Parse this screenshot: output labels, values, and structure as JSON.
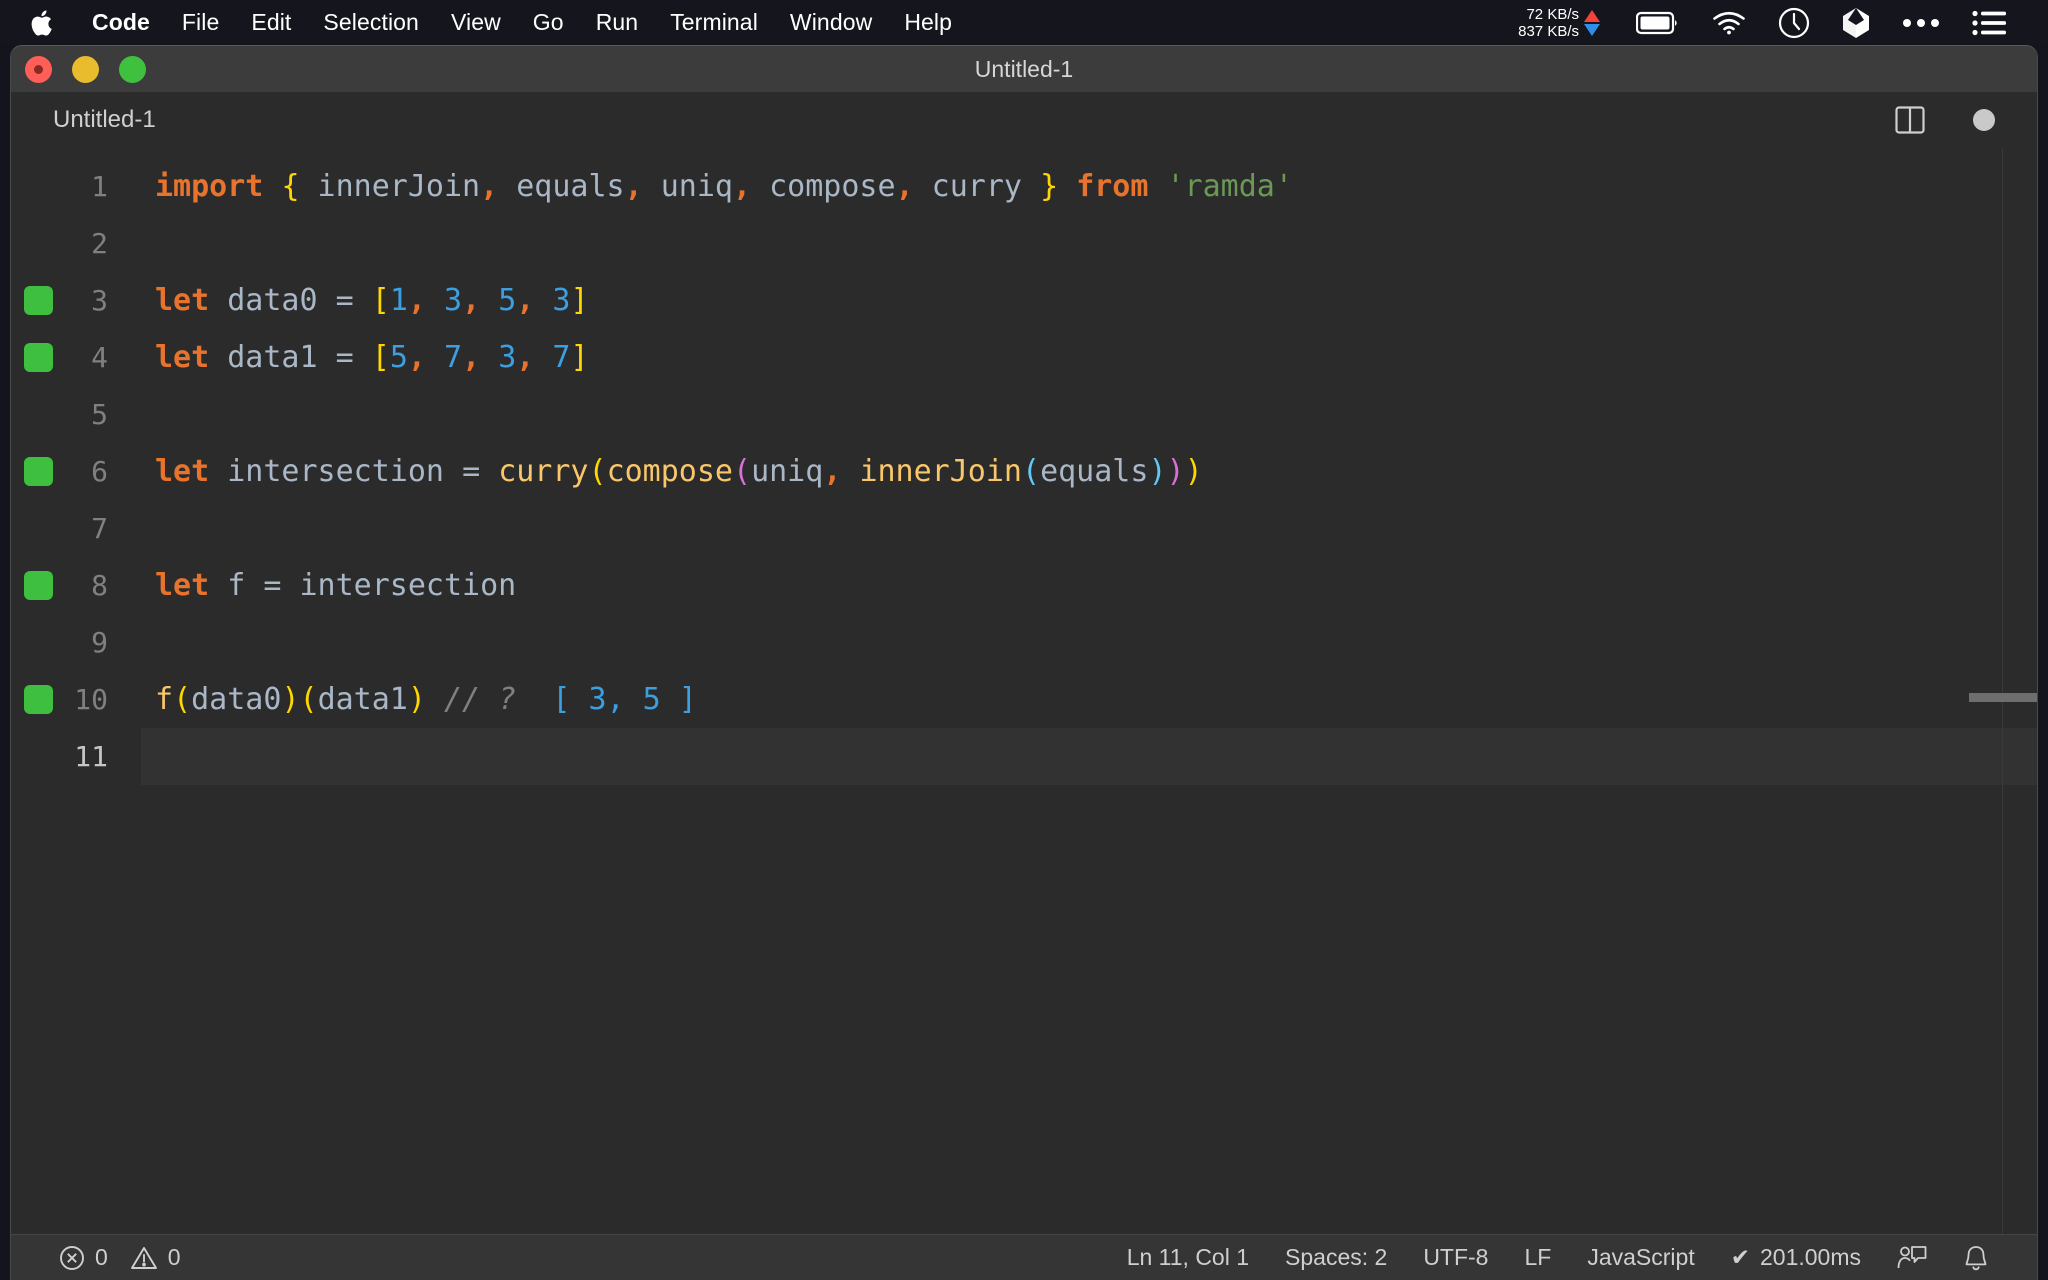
{
  "menubar": {
    "apple_icon": "apple-logo-icon",
    "items": [
      {
        "label": "Code",
        "bold": true
      },
      {
        "label": "File",
        "bold": false
      },
      {
        "label": "Edit",
        "bold": false
      },
      {
        "label": "Selection",
        "bold": false
      },
      {
        "label": "View",
        "bold": false
      },
      {
        "label": "Go",
        "bold": false
      },
      {
        "label": "Run",
        "bold": false
      },
      {
        "label": "Terminal",
        "bold": false
      },
      {
        "label": "Window",
        "bold": false
      },
      {
        "label": "Help",
        "bold": false
      }
    ],
    "network": {
      "upload": "72 KB/s",
      "download": "837 KB/s",
      "upload_color": "#f2433b",
      "download_color": "#2f8fe8"
    },
    "tray_icons": [
      "battery-icon",
      "wifi-icon",
      "clock-icon",
      "dropbox-icon",
      "ellipsis-icon",
      "control-center-list-icon"
    ]
  },
  "window": {
    "title": "Untitled-1",
    "traffic_lights": [
      "close-button",
      "minimize-button",
      "maximize-button"
    ]
  },
  "tabbar": {
    "tab_label": "Untitled-1",
    "split_editor_icon": "split-editor-icon",
    "dirty_indicator": "unsaved-changes-dot"
  },
  "editor": {
    "lines": [
      {
        "no": "1",
        "breakpoint": false,
        "active": false,
        "tokens": [
          {
            "t": "import",
            "c": "kw"
          },
          {
            "t": " ",
            "c": "punct"
          },
          {
            "t": "{",
            "c": "b1"
          },
          {
            "t": " innerJoin",
            "c": "ident"
          },
          {
            "t": ",",
            "c": "kw"
          },
          {
            "t": " equals",
            "c": "ident"
          },
          {
            "t": ",",
            "c": "kw"
          },
          {
            "t": " uniq",
            "c": "ident"
          },
          {
            "t": ",",
            "c": "kw"
          },
          {
            "t": " compose",
            "c": "ident"
          },
          {
            "t": ",",
            "c": "kw"
          },
          {
            "t": " curry ",
            "c": "ident"
          },
          {
            "t": "}",
            "c": "b1"
          },
          {
            "t": " ",
            "c": "punct"
          },
          {
            "t": "from",
            "c": "kw"
          },
          {
            "t": " ",
            "c": "punct"
          },
          {
            "t": "'ramda'",
            "c": "str"
          }
        ]
      },
      {
        "no": "2",
        "breakpoint": false,
        "active": false,
        "tokens": []
      },
      {
        "no": "3",
        "breakpoint": true,
        "active": false,
        "tokens": [
          {
            "t": "let",
            "c": "kw"
          },
          {
            "t": " data0 ",
            "c": "ident"
          },
          {
            "t": "=",
            "c": "op"
          },
          {
            "t": " ",
            "c": "punct"
          },
          {
            "t": "[",
            "c": "b1"
          },
          {
            "t": "1",
            "c": "num"
          },
          {
            "t": ",",
            "c": "kw"
          },
          {
            "t": " ",
            "c": "punct"
          },
          {
            "t": "3",
            "c": "num"
          },
          {
            "t": ",",
            "c": "kw"
          },
          {
            "t": " ",
            "c": "punct"
          },
          {
            "t": "5",
            "c": "num"
          },
          {
            "t": ",",
            "c": "kw"
          },
          {
            "t": " ",
            "c": "punct"
          },
          {
            "t": "3",
            "c": "num"
          },
          {
            "t": "]",
            "c": "b1"
          }
        ]
      },
      {
        "no": "4",
        "breakpoint": true,
        "active": false,
        "tokens": [
          {
            "t": "let",
            "c": "kw"
          },
          {
            "t": " data1 ",
            "c": "ident"
          },
          {
            "t": "=",
            "c": "op"
          },
          {
            "t": " ",
            "c": "punct"
          },
          {
            "t": "[",
            "c": "b1"
          },
          {
            "t": "5",
            "c": "num"
          },
          {
            "t": ",",
            "c": "kw"
          },
          {
            "t": " ",
            "c": "punct"
          },
          {
            "t": "7",
            "c": "num"
          },
          {
            "t": ",",
            "c": "kw"
          },
          {
            "t": " ",
            "c": "punct"
          },
          {
            "t": "3",
            "c": "num"
          },
          {
            "t": ",",
            "c": "kw"
          },
          {
            "t": " ",
            "c": "punct"
          },
          {
            "t": "7",
            "c": "num"
          },
          {
            "t": "]",
            "c": "b1"
          }
        ]
      },
      {
        "no": "5",
        "breakpoint": false,
        "active": false,
        "tokens": []
      },
      {
        "no": "6",
        "breakpoint": true,
        "active": false,
        "tokens": [
          {
            "t": "let",
            "c": "kw"
          },
          {
            "t": " intersection ",
            "c": "ident"
          },
          {
            "t": "=",
            "c": "op"
          },
          {
            "t": " ",
            "c": "punct"
          },
          {
            "t": "curry",
            "c": "fn"
          },
          {
            "t": "(",
            "c": "b1"
          },
          {
            "t": "compose",
            "c": "fn"
          },
          {
            "t": "(",
            "c": "b2"
          },
          {
            "t": "uniq",
            "c": "ident"
          },
          {
            "t": ",",
            "c": "kw"
          },
          {
            "t": " ",
            "c": "punct"
          },
          {
            "t": "innerJoin",
            "c": "fn"
          },
          {
            "t": "(",
            "c": "b3"
          },
          {
            "t": "equals",
            "c": "ident"
          },
          {
            "t": ")",
            "c": "b3"
          },
          {
            "t": ")",
            "c": "b2"
          },
          {
            "t": ")",
            "c": "b1"
          }
        ]
      },
      {
        "no": "7",
        "breakpoint": false,
        "active": false,
        "tokens": []
      },
      {
        "no": "8",
        "breakpoint": true,
        "active": false,
        "tokens": [
          {
            "t": "let",
            "c": "kw"
          },
          {
            "t": " f ",
            "c": "ident"
          },
          {
            "t": "=",
            "c": "op"
          },
          {
            "t": " intersection",
            "c": "ident"
          }
        ]
      },
      {
        "no": "9",
        "breakpoint": false,
        "active": false,
        "tokens": []
      },
      {
        "no": "10",
        "breakpoint": true,
        "active": false,
        "tokens": [
          {
            "t": "f",
            "c": "fn"
          },
          {
            "t": "(",
            "c": "b1"
          },
          {
            "t": "data0",
            "c": "ident"
          },
          {
            "t": ")",
            "c": "b1"
          },
          {
            "t": "(",
            "c": "b1"
          },
          {
            "t": "data1",
            "c": "ident"
          },
          {
            "t": ")",
            "c": "b1"
          },
          {
            "t": " ",
            "c": "punct"
          },
          {
            "t": "// ?",
            "c": "comment"
          },
          {
            "t": "  ",
            "c": "punct"
          },
          {
            "t": "[ 3, 5 ]",
            "c": "result"
          }
        ]
      },
      {
        "no": "11",
        "breakpoint": false,
        "active": true,
        "tokens": []
      }
    ]
  },
  "statusbar": {
    "errors_icon": "error-circle-icon",
    "errors_count": "0",
    "warnings_icon": "warning-triangle-icon",
    "warnings_count": "0",
    "cursor_position": "Ln 11, Col 1",
    "indentation": "Spaces: 2",
    "encoding": "UTF-8",
    "eol": "LF",
    "language": "JavaScript",
    "timing_check": "✔",
    "timing": "201.00ms",
    "feedback_icon": "feedback-person-icon",
    "notifications_icon": "bell-icon"
  }
}
